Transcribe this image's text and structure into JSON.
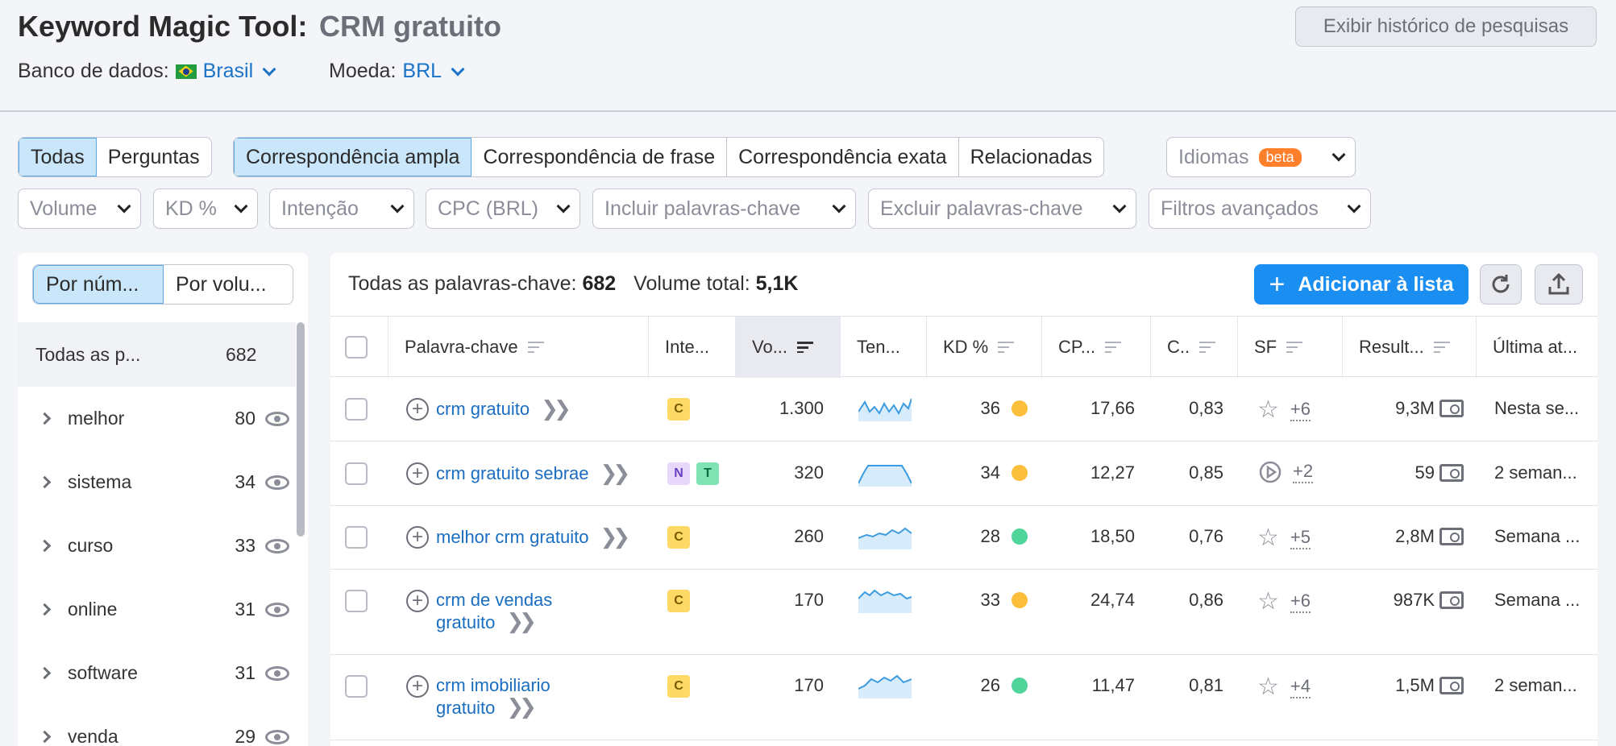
{
  "header": {
    "title": "Keyword Magic Tool:",
    "keyword": "CRM gratuito",
    "history_button": "Exibir histórico de pesquisas",
    "database_label": "Banco de dados:",
    "database_value": "Brasil",
    "currency_label": "Moeda:",
    "currency_value": "BRL"
  },
  "filters": {
    "type_tabs": [
      "Todas",
      "Perguntas"
    ],
    "match_tabs": [
      "Correspondência ampla",
      "Correspondência de frase",
      "Correspondência exata",
      "Relacionadas"
    ],
    "languages": "Idiomas",
    "beta": "beta",
    "dropdowns": [
      "Volume",
      "KD %",
      "Intenção",
      "CPC (BRL)",
      "Incluir palavras-chave",
      "Excluir palavras-chave",
      "Filtros avançados"
    ]
  },
  "left_panel": {
    "toggle": [
      "Por núm...",
      "Por volu..."
    ],
    "all_label": "Todas as p...",
    "all_count": "682",
    "groups": [
      {
        "label": "melhor",
        "count": "80"
      },
      {
        "label": "sistema",
        "count": "34"
      },
      {
        "label": "curso",
        "count": "33"
      },
      {
        "label": "online",
        "count": "31"
      },
      {
        "label": "software",
        "count": "31"
      },
      {
        "label": "venda",
        "count": "29"
      }
    ]
  },
  "main": {
    "all_keywords_label": "Todas as palavras-chave:",
    "all_keywords_count": "682",
    "total_volume_label": "Volume total:",
    "total_volume_value": "5,1K",
    "add_button": "Adicionar à lista",
    "columns": [
      "Palavra-chave",
      "Inte...",
      "Vo...",
      "Ten...",
      "KD %",
      "CP...",
      "C..",
      "SF",
      "Result...",
      "Última at..."
    ],
    "rows": [
      {
        "keyword_1": "crm gratuito",
        "keyword_2": "",
        "intents": [
          "C"
        ],
        "volume": "1.300",
        "kd": "36",
        "kd_color": "#fbbf3c",
        "cpc": "17,66",
        "com": "0,83",
        "sf_icon": "star-icon",
        "sf_more": "+6",
        "results": "9,3M",
        "updated": "Nesta se..."
      },
      {
        "keyword_1": "crm gratuito sebrae",
        "keyword_2": "",
        "intents": [
          "N",
          "T"
        ],
        "volume": "320",
        "kd": "34",
        "kd_color": "#fbbf3c",
        "cpc": "12,27",
        "com": "0,85",
        "sf_icon": "play-icon",
        "sf_more": "+2",
        "results": "59",
        "updated": "2 seman..."
      },
      {
        "keyword_1": "melhor crm gratuito",
        "keyword_2": "",
        "intents": [
          "C"
        ],
        "volume": "260",
        "kd": "28",
        "kd_color": "#4fd49a",
        "cpc": "18,50",
        "com": "0,76",
        "sf_icon": "star-icon",
        "sf_more": "+5",
        "results": "2,8M",
        "updated": "Semana ..."
      },
      {
        "keyword_1": "crm de vendas",
        "keyword_2": "gratuito",
        "intents": [
          "C"
        ],
        "volume": "170",
        "kd": "33",
        "kd_color": "#fbbf3c",
        "cpc": "24,74",
        "com": "0,86",
        "sf_icon": "star-icon",
        "sf_more": "+6",
        "results": "987K",
        "updated": "Semana ..."
      },
      {
        "keyword_1": "crm imobiliario",
        "keyword_2": "gratuito",
        "intents": [
          "C"
        ],
        "volume": "170",
        "kd": "26",
        "kd_color": "#4fd49a",
        "cpc": "11,47",
        "com": "0,81",
        "sf_icon": "star-icon",
        "sf_more": "+4",
        "results": "1,5M",
        "updated": "2 seman..."
      }
    ]
  },
  "colors": {
    "accent": "#1b8ef2",
    "link": "#1a73c8",
    "selected_tab": "#c9e6fb"
  }
}
